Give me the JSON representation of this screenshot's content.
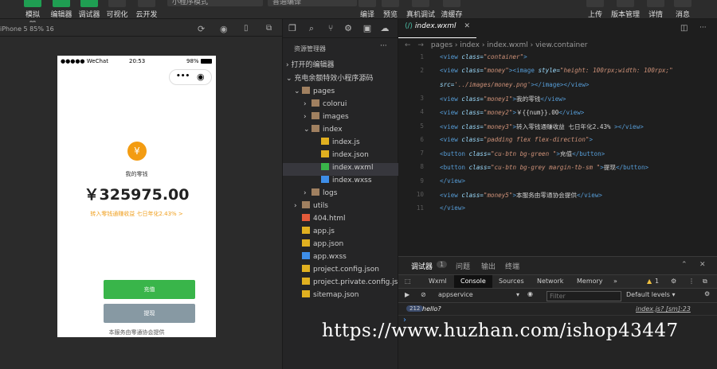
{
  "toolbar": {
    "left_buttons": [
      "模拟器",
      "编辑器",
      "调试器",
      "可视化",
      "云开发"
    ],
    "mode_select": "小程序模式",
    "compile_select": "普通编译",
    "mid_buttons": [
      "编译",
      "预览",
      "真机调试",
      "清缓存"
    ],
    "right_buttons": [
      "上传",
      "版本管理",
      "详情",
      "消息"
    ]
  },
  "simulator": {
    "device": "iPhone 5 85% 16",
    "status_left": "●●●●● WeChat",
    "status_time": "20:53",
    "status_battery": "98%",
    "money_label": "我的零钱",
    "money_value": "￥325975.00",
    "money_rate": "转入零钱通赚收益 七日年化2.43% >",
    "btn_charge": "充值",
    "btn_withdraw": "提现",
    "footer": "本服务由零通协会提供"
  },
  "explorer": {
    "title": "资源管理器",
    "open_editors": "打开的编辑器",
    "project": "充电余额特效小程序源码",
    "tree": [
      {
        "label": "pages",
        "indent": 0,
        "type": "folder-open"
      },
      {
        "label": "colorui",
        "indent": 1,
        "type": "folder"
      },
      {
        "label": "images",
        "indent": 1,
        "type": "folder"
      },
      {
        "label": "index",
        "indent": 1,
        "type": "folder-open"
      },
      {
        "label": "index.js",
        "indent": 2,
        "type": "js"
      },
      {
        "label": "index.json",
        "indent": 2,
        "type": "json"
      },
      {
        "label": "index.wxml",
        "indent": 2,
        "type": "wxml"
      },
      {
        "label": "index.wxss",
        "indent": 2,
        "type": "wxss"
      },
      {
        "label": "logs",
        "indent": 1,
        "type": "folder"
      },
      {
        "label": "utils",
        "indent": 0,
        "type": "folder"
      },
      {
        "label": "404.html",
        "indent": 0,
        "type": "html"
      },
      {
        "label": "app.js",
        "indent": 0,
        "type": "js"
      },
      {
        "label": "app.json",
        "indent": 0,
        "type": "json"
      },
      {
        "label": "app.wxss",
        "indent": 0,
        "type": "wxss"
      },
      {
        "label": "project.config.json",
        "indent": 0,
        "type": "json"
      },
      {
        "label": "project.private.config.js...",
        "indent": 0,
        "type": "json"
      },
      {
        "label": "sitemap.json",
        "indent": 0,
        "type": "json"
      }
    ]
  },
  "editor": {
    "tab": "index.wxml",
    "breadcrumb": [
      "pages",
      "index",
      "index.wxml",
      "view.container"
    ],
    "lines": [
      {
        "n": "1",
        "code": "<view class=\"container\">"
      },
      {
        "n": "2",
        "code": "  <view class=\"money\"><image  style=\"height: 100rpx;width: 100rpx;\""
      },
      {
        "n": "",
        "code": "  src='../images/money.png'></image></view>"
      },
      {
        "n": "3",
        "code": "  <view class=\"money1\">我的零钱</view>"
      },
      {
        "n": "4",
        "code": "  <view class=\"money2\">￥{{num}}.00</view>"
      },
      {
        "n": "5",
        "code": "  <view class=\"money3\">转入零钱通赚收益 七日年化2.43% ></view>"
      },
      {
        "n": "6",
        "code": "  <view class=\"padding flex flex-direction\">"
      },
      {
        "n": "7",
        "code": "    <button class=\"cu-btn bg-green \">充值</button>"
      },
      {
        "n": "8",
        "code": "    <button class=\"cu-btn bg-grey margin-tb-sm \">提现</button>"
      },
      {
        "n": "9",
        "code": "  </view>"
      },
      {
        "n": "10",
        "code": "  <view class=\"money5\">本服务由零通协会提供</view>"
      },
      {
        "n": "11",
        "code": "</view>"
      }
    ]
  },
  "debug": {
    "tabs": [
      "调试器",
      "1",
      "问题",
      "输出",
      "终端"
    ],
    "dev_tabs": [
      "Wxml",
      "Console",
      "Sources",
      "Network",
      "Memory",
      "»"
    ],
    "warn_count": "1",
    "context": "appservice",
    "filter_placeholder": "Filter",
    "levels": "Default levels",
    "log_count": "212",
    "log_msg": "hello?",
    "log_src": "index.js? [sm]:23"
  },
  "watermark": "https://www.huzhan.com/ishop43447",
  "colors": {
    "accent": "#1f9e52",
    "green_btn": "#39b54a",
    "grey_btn": "#8799a3",
    "coin": "#f39c12"
  }
}
